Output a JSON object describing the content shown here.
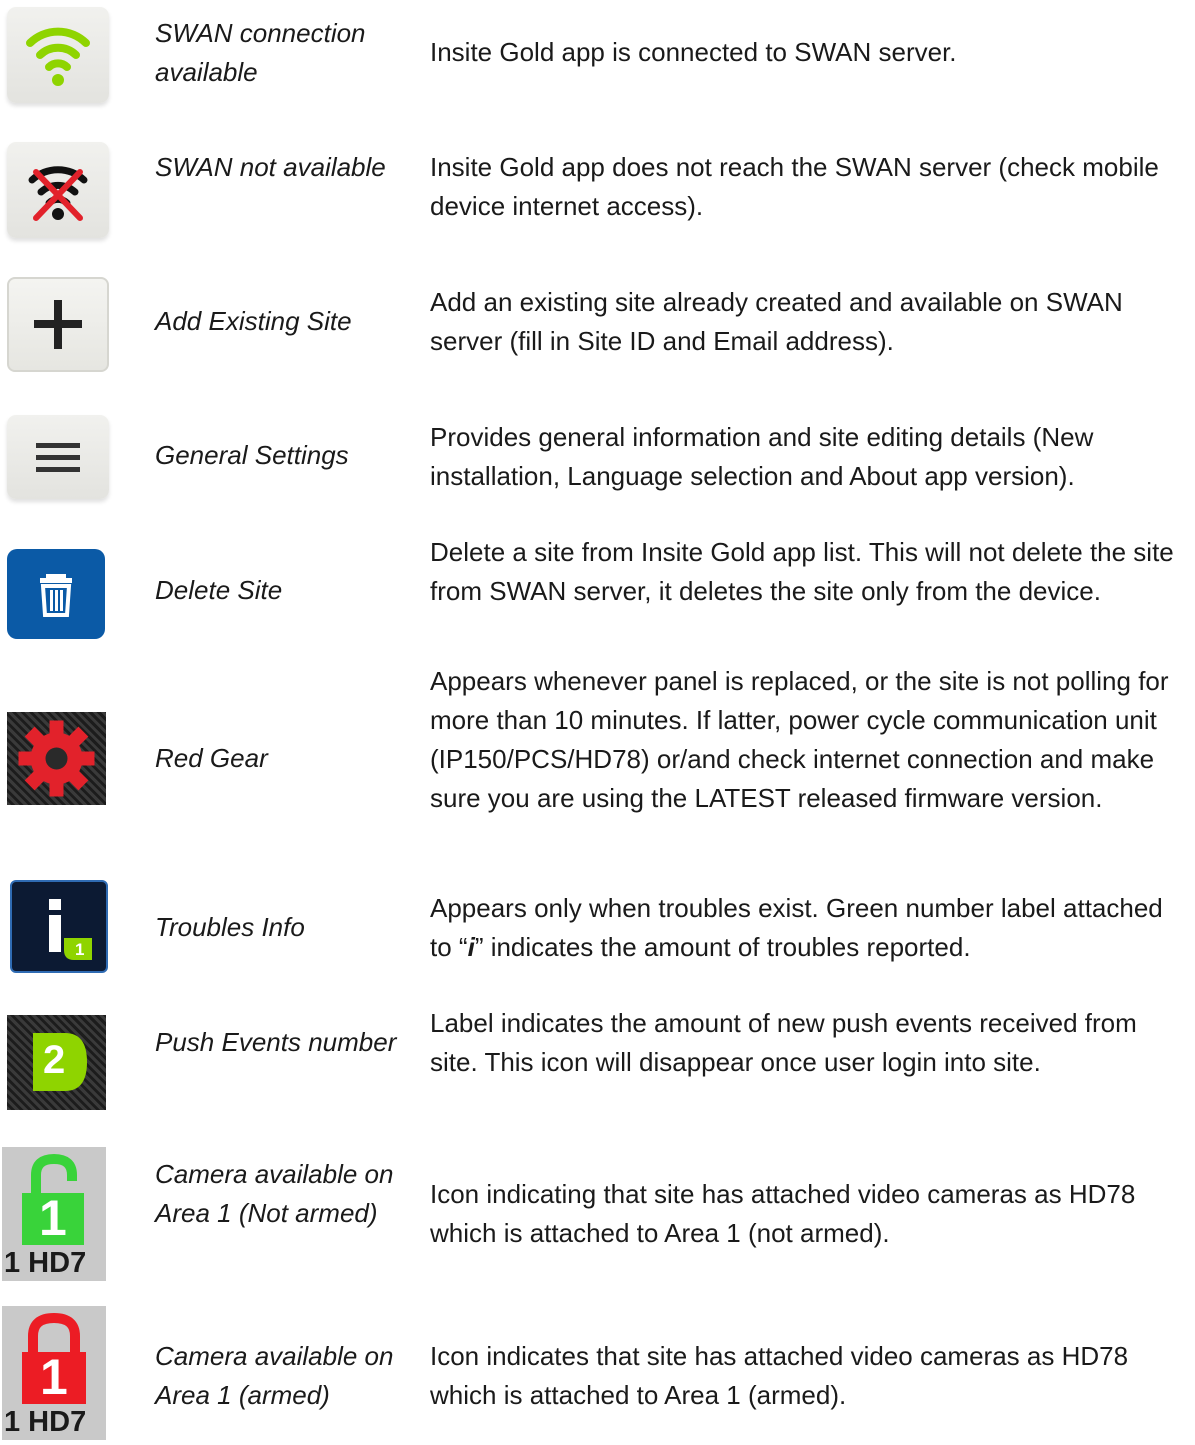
{
  "colors": {
    "wifi_green": "#8fd400",
    "delete_blue": "#0b5aa6",
    "gear_red": "#e2222b",
    "info_navy": "#0c1a33",
    "push_green": "#8fd400",
    "lock_green": "#39d33a",
    "lock_red": "#ec1c24"
  },
  "rows": [
    {
      "icon": "wifi-icon",
      "name": "SWAN connection available",
      "desc": "Insite Gold app is connected to SWAN server."
    },
    {
      "icon": "wifi-off-icon",
      "name": "SWAN not available",
      "desc": "Insite Gold app does not reach the SWAN server (check mobile device internet access)."
    },
    {
      "icon": "plus-icon",
      "name": "Add Existing Site",
      "desc": "Add an existing site already created and available on SWAN server (fill in Site ID and Email address)."
    },
    {
      "icon": "menu-icon",
      "name": "General Settings",
      "desc": "Provides general information and site editing details (New installation, Language selection and About app version)."
    },
    {
      "icon": "trash-icon",
      "name": "Delete Site",
      "desc": "Delete a site from Insite Gold app list. This will not delete the site from SWAN server, it deletes the site only from the device."
    },
    {
      "icon": "red-gear-icon",
      "name": "Red Gear",
      "desc": "Appears whenever panel is replaced, or the site is not polling for more than 10 minutes. If latter, power cycle communication unit (IP150/PCS/HD78) or/and check internet connection and make sure you are using the LATEST released firmware version."
    },
    {
      "icon": "info-icon",
      "name": "Troubles Info",
      "desc_before": "Appears only when troubles exist. Green number label attached to “",
      "desc_em": "i",
      "desc_after": "” indicates the amount of troubles reported.",
      "badge": "1"
    },
    {
      "icon": "push-badge-icon",
      "name": "Push Events number",
      "desc": "Label indicates the amount of new push events received from site. This icon will disappear once user login into site.",
      "badge": "2"
    },
    {
      "icon": "unlocked-area-icon",
      "name": "Camera available on Area 1 (Not armed)",
      "desc": "Icon indicating that site has attached video cameras as HD78 which is attached to Area 1 (not armed).",
      "area": "1",
      "caption": "1 HD7"
    },
    {
      "icon": "locked-area-icon",
      "name": "Camera available on Area 1 (armed)",
      "desc": "Icon indicates that site has attached video cameras as HD78 which is attached to Area 1 (armed).",
      "area": "1",
      "caption": "1 HD7"
    }
  ]
}
